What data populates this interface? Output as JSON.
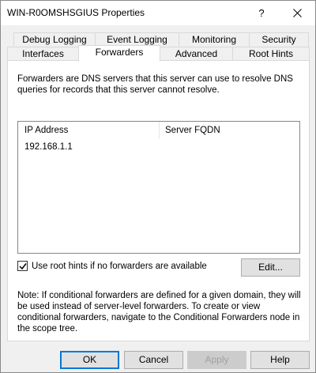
{
  "window": {
    "title": "WIN-R0OMSHSGIUS Properties",
    "help_symbol": "?"
  },
  "tabs": {
    "row1": [
      "Debug Logging",
      "Event Logging",
      "Monitoring",
      "Security"
    ],
    "row2": [
      "Interfaces",
      "Forwarders",
      "Advanced",
      "Root Hints"
    ],
    "active": "Forwarders"
  },
  "forwarders": {
    "description": "Forwarders are DNS servers that this server can use to resolve DNS queries for records that this server cannot resolve.",
    "columns": [
      "IP Address",
      "Server FQDN"
    ],
    "rows": [
      {
        "ip": "192.168.1.1",
        "fqdn": ""
      }
    ],
    "root_hints_checkbox": {
      "label": "Use root hints if no forwarders are available",
      "checked": true
    },
    "edit_button": "Edit...",
    "note": "Note: If conditional forwarders are defined for a given domain, they will be used instead of server-level forwarders.  To create or view conditional forwarders, navigate to the Conditional Forwarders node in the scope tree."
  },
  "buttons": {
    "ok": "OK",
    "cancel": "Cancel",
    "apply": "Apply",
    "help": "Help"
  }
}
